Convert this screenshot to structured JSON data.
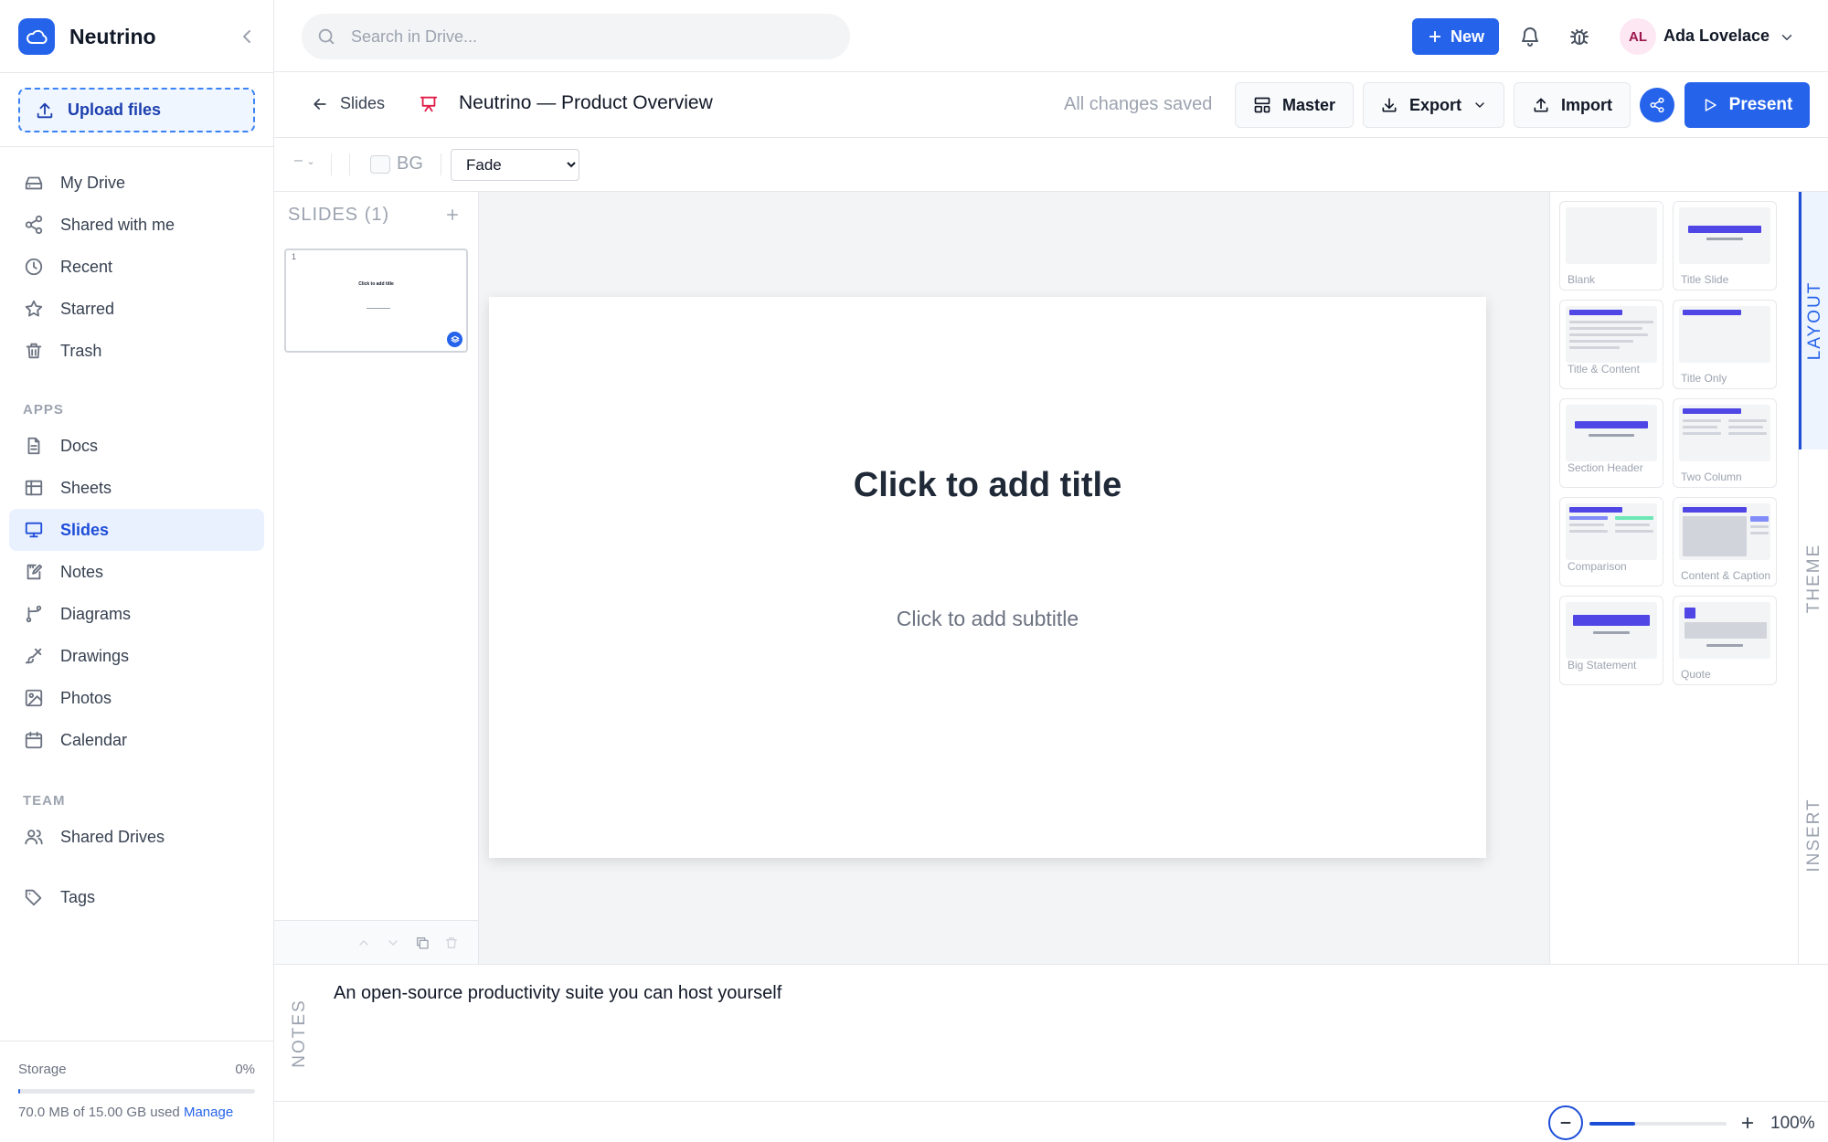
{
  "app": {
    "name": "Neutrino"
  },
  "sidebar": {
    "upload_label": "Upload files",
    "nav": [
      {
        "label": "My Drive",
        "icon": "drive-icon"
      },
      {
        "label": "Shared with me",
        "icon": "share-icon"
      },
      {
        "label": "Recent",
        "icon": "clock-icon"
      },
      {
        "label": "Starred",
        "icon": "star-icon"
      },
      {
        "label": "Trash",
        "icon": "trash-icon"
      }
    ],
    "apps_heading": "APPS",
    "apps": [
      {
        "label": "Docs",
        "icon": "doc-icon"
      },
      {
        "label": "Sheets",
        "icon": "sheet-icon"
      },
      {
        "label": "Slides",
        "icon": "slides-icon",
        "active": true
      },
      {
        "label": "Notes",
        "icon": "notes-icon"
      },
      {
        "label": "Diagrams",
        "icon": "diagram-icon"
      },
      {
        "label": "Drawings",
        "icon": "brush-icon"
      },
      {
        "label": "Photos",
        "icon": "photo-icon"
      },
      {
        "label": "Calendar",
        "icon": "calendar-icon"
      }
    ],
    "team_heading": "TEAM",
    "team": [
      {
        "label": "Shared Drives",
        "icon": "users-icon"
      }
    ],
    "tags_label": "Tags",
    "storage": {
      "label": "Storage",
      "percent_label": "0%",
      "used_fraction": 0.005,
      "used_text": "70.0 MB of 15.00 GB used",
      "manage_label": "Manage"
    }
  },
  "topbar": {
    "search_placeholder": "Search in Drive...",
    "new_label": "New",
    "user": {
      "initials": "AL",
      "name": "Ada Lovelace"
    }
  },
  "docbar": {
    "back_label": "Slides",
    "title": "Neutrino — Product Overview",
    "save_status": "All changes saved",
    "master_label": "Master",
    "export_label": "Export",
    "import_label": "Import",
    "present_label": "Present"
  },
  "toolbar": {
    "line_symbol": "–",
    "bg_label": "BG",
    "transition": {
      "selected": "Fade"
    }
  },
  "slides_panel": {
    "header": "SLIDES (1)",
    "slides": [
      {
        "number": "1",
        "title": "Click to add title"
      }
    ]
  },
  "slide": {
    "title": "Click to add title",
    "subtitle": "Click to add subtitle"
  },
  "layouts": [
    {
      "name": "Blank"
    },
    {
      "name": "Title Slide"
    },
    {
      "name": "Title & Content"
    },
    {
      "name": "Title Only"
    },
    {
      "name": "Section Header"
    },
    {
      "name": "Two Column"
    },
    {
      "name": "Comparison"
    },
    {
      "name": "Content & Caption"
    },
    {
      "name": "Big Statement"
    },
    {
      "name": "Quote"
    }
  ],
  "right_tabs": [
    {
      "label": "LAYOUT",
      "active": true
    },
    {
      "label": "THEME"
    },
    {
      "label": "INSERT"
    }
  ],
  "notes": {
    "label": "NOTES",
    "text": "An open-source productivity suite you can host yourself"
  },
  "zoom": {
    "value_label": "100%",
    "slider_fraction": 0.33
  },
  "colors": {
    "accent": "#2563eb",
    "layout_accent": "#4f46e5",
    "slides_icon": "#e11d48"
  }
}
